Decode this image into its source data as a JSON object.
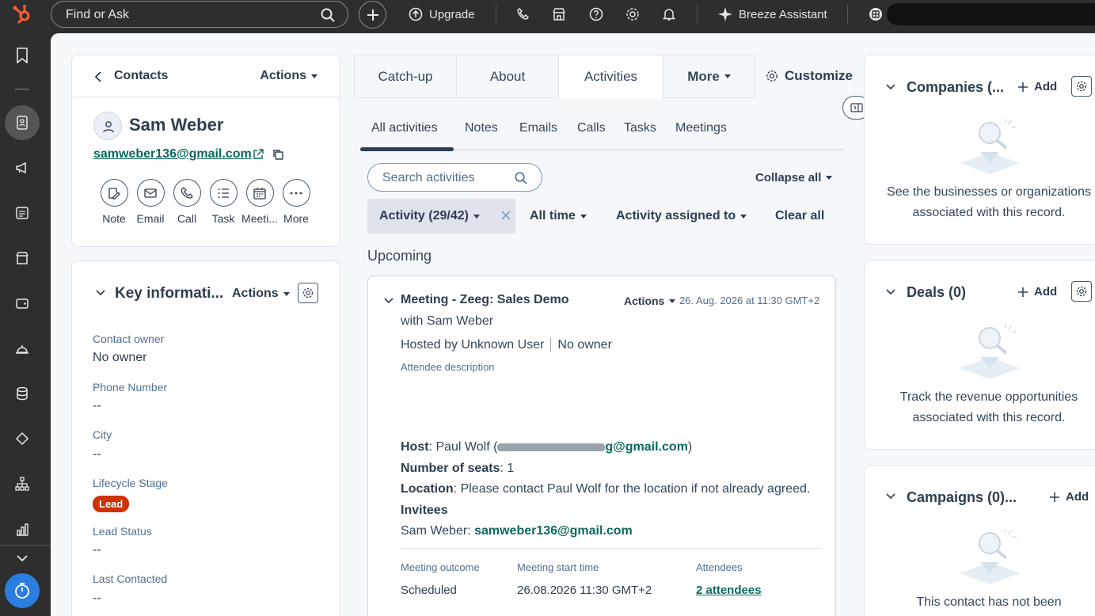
{
  "topbar": {
    "search_placeholder": "Find or Ask",
    "upgrade": "Upgrade",
    "breeze": "Breeze Assistant"
  },
  "contact": {
    "breadcrumb": "Contacts",
    "actions": "Actions",
    "name": "Sam Weber",
    "email": "samweber136@gmail.com",
    "quick_actions": [
      "Note",
      "Email",
      "Call",
      "Task",
      "Meeti...",
      "More"
    ]
  },
  "key_info": {
    "title": "Key informati...",
    "actions": "Actions",
    "props": [
      {
        "label": "Contact owner",
        "value": "No owner"
      },
      {
        "label": "Phone Number",
        "value": "--"
      },
      {
        "label": "City",
        "value": "--"
      },
      {
        "label": "Lifecycle Stage",
        "value": "Lead"
      },
      {
        "label": "Lead Status",
        "value": "--"
      },
      {
        "label": "Last Contacted",
        "value": "--"
      }
    ]
  },
  "tabs": [
    "Catch-up",
    "About",
    "Activities",
    "More"
  ],
  "customize": "Customize",
  "subtabs": [
    "All activities",
    "Notes",
    "Emails",
    "Calls",
    "Tasks",
    "Meetings"
  ],
  "activity_search_placeholder": "Search activities",
  "collapse_all": "Collapse all",
  "filters": {
    "activity": "Activity (29/42)",
    "time": "All time",
    "assigned": "Activity assigned to",
    "clear": "Clear all"
  },
  "upcoming": "Upcoming",
  "meeting": {
    "title": "Meeting - Zeeg: Sales Demo",
    "actions": "Actions",
    "date": "26. Aug. 2026 at 11:30 GMT+2",
    "with": "with Sam Weber",
    "hosted_by": "Hosted by Unknown User",
    "owner": "No owner",
    "attendee_desc": "Attendee description",
    "host_label": "Host",
    "host_value": ": Paul Wolf (",
    "host_email_tail": "g@gmail.com",
    "host_close": ")",
    "seats_label": "Number of seats",
    "seats_value": ": 1",
    "location_label": "Location",
    "location_value": ": Please contact Paul Wolf for the location if not already agreed.",
    "invitees_label": "Invitees",
    "invitee_name": "Sam Weber: ",
    "invitee_email": "samweber136@gmail.com",
    "outcome_label": "Meeting outcome",
    "outcome_value": "Scheduled",
    "start_label": "Meeting start time",
    "start_value": "26.08.2026 11:30 GMT+2",
    "attendees_label": "Attendees",
    "attendees_value": "2 attendees"
  },
  "side": {
    "add": "Add",
    "companies_title": "Companies (...",
    "companies_text": "See the businesses or organizations associated with this record.",
    "deals_title": "Deals (0)",
    "deals_text": "Track the revenue opportunities associated with this record.",
    "campaigns_title": "Campaigns (0)...",
    "campaigns_text": "This contact has not been"
  }
}
